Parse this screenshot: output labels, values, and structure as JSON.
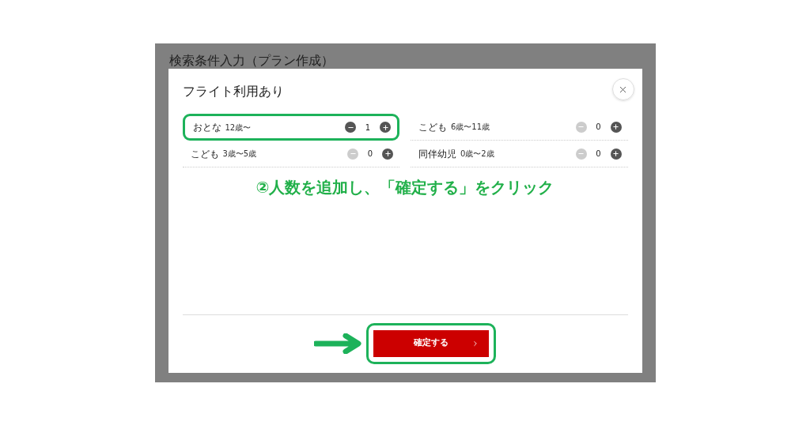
{
  "page_title": "検索条件入力（プラン作成）",
  "dialog": {
    "title": "フライト利用あり",
    "rows": [
      {
        "label": "おとな",
        "age": "12歳〜",
        "count": "1",
        "minus_disabled": false,
        "highlighted": true
      },
      {
        "label": "こども",
        "age": "6歳〜11歳",
        "count": "0",
        "minus_disabled": true,
        "highlighted": false
      },
      {
        "label": "こども",
        "age": "3歳〜5歳",
        "count": "0",
        "minus_disabled": true,
        "highlighted": false
      },
      {
        "label": "同伴幼児",
        "age": "0歳〜2歳",
        "count": "0",
        "minus_disabled": true,
        "highlighted": false
      }
    ],
    "annotation": "②人数を追加し、「確定する」をクリック",
    "confirm_button": {
      "label": "確定する",
      "highlighted": true
    }
  }
}
